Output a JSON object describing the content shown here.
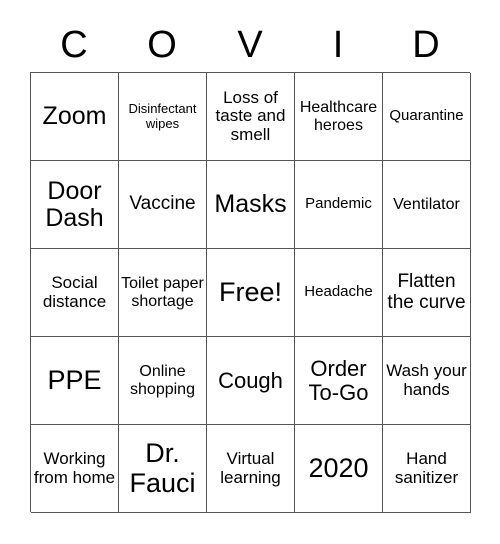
{
  "card": {
    "title_letters": [
      "C",
      "O",
      "V",
      "I",
      "D"
    ],
    "columns": 5,
    "rows": 5,
    "border_color": "#555555",
    "background_color": "#ffffff",
    "text_color": "#000000",
    "cells": [
      {
        "text": "Zoom",
        "size": "fs-huge"
      },
      {
        "text": "Disinfectant wipes",
        "size": "fs-xs"
      },
      {
        "text": "Loss of taste and smell",
        "size": "fs-lg"
      },
      {
        "text": "Healthcare heroes",
        "size": "fs-md"
      },
      {
        "text": "Quarantine",
        "size": "fs-sm"
      },
      {
        "text": "Door Dash",
        "size": "fs-huge"
      },
      {
        "text": "Vaccine",
        "size": "fs-xl"
      },
      {
        "text": "Masks",
        "size": "fs-huge"
      },
      {
        "text": "Pandemic",
        "size": "fs-sm"
      },
      {
        "text": "Ventilator",
        "size": "fs-md"
      },
      {
        "text": "Social distance",
        "size": "fs-lg"
      },
      {
        "text": "Toilet paper shortage",
        "size": "fs-md"
      },
      {
        "text": "Free!",
        "size": "fs-mega"
      },
      {
        "text": "Headache",
        "size": "fs-sm"
      },
      {
        "text": "Flatten the curve",
        "size": "fs-xl"
      },
      {
        "text": "PPE",
        "size": "fs-mega"
      },
      {
        "text": "Online shopping",
        "size": "fs-md"
      },
      {
        "text": "Cough",
        "size": "fs-xxl"
      },
      {
        "text": "Order To-Go",
        "size": "fs-xxl"
      },
      {
        "text": "Wash your hands",
        "size": "fs-lg"
      },
      {
        "text": "Working from home",
        "size": "fs-lg"
      },
      {
        "text": "Dr. Fauci",
        "size": "fs-mega"
      },
      {
        "text": "Virtual learning",
        "size": "fs-lg"
      },
      {
        "text": "2020",
        "size": "fs-mega"
      },
      {
        "text": "Hand sanitizer",
        "size": "fs-lg"
      }
    ]
  }
}
